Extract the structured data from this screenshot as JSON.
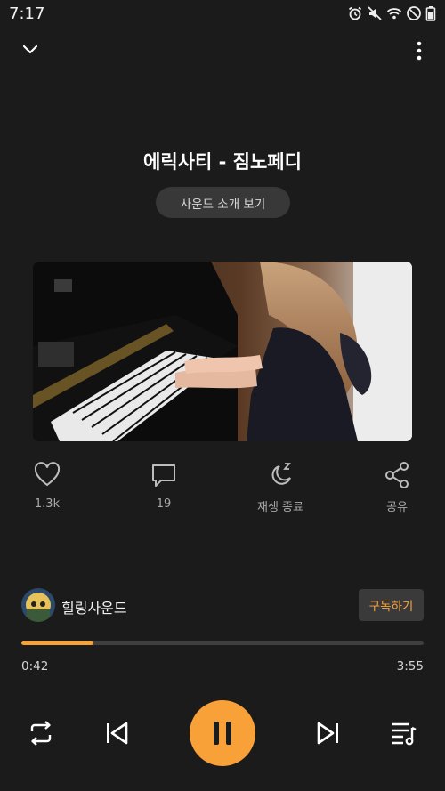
{
  "status_bar": {
    "time": "7:17",
    "icons": [
      "alarm-icon",
      "mute-icon",
      "wifi-icon",
      "do-not-disturb-icon",
      "battery-icon"
    ]
  },
  "top_bar": {
    "collapse_icon": "chevron-down-icon",
    "more_icon": "more-vertical-icon"
  },
  "track": {
    "title": "에릭사티 - 짐노페디",
    "intro_button": "사운드 소개 보기"
  },
  "actions": {
    "like": {
      "icon": "heart-icon",
      "label": "1.3k"
    },
    "comment": {
      "icon": "comment-icon",
      "label": "19"
    },
    "sleep_timer": {
      "icon": "sleep-timer-icon",
      "label": "재생 종료"
    },
    "share": {
      "icon": "share-icon",
      "label": "공유"
    }
  },
  "channel": {
    "name": "힐링사운드",
    "subscribe_label": "구독하기"
  },
  "playback": {
    "elapsed": "0:42",
    "total": "3:55",
    "progress_fraction": 0.18
  },
  "controls": {
    "repeat_icon": "repeat-icon",
    "previous_icon": "skip-previous-icon",
    "play_pause_icon": "pause-icon",
    "next_icon": "skip-next-icon",
    "playlist_icon": "playlist-icon"
  },
  "colors": {
    "background": "#1b1b1b",
    "accent": "#f7a138",
    "chip": "#383838",
    "muted_text": "#a9a9a9"
  }
}
